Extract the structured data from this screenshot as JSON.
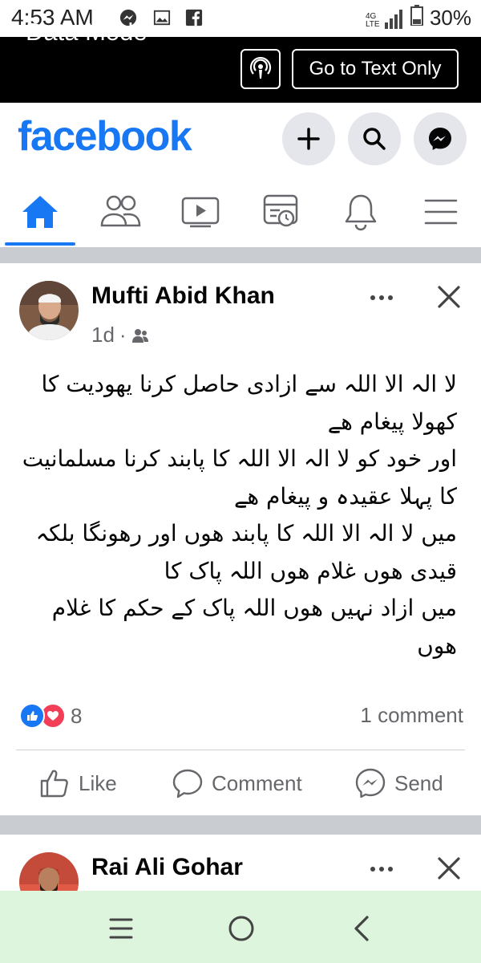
{
  "status_bar": {
    "time": "4:53 AM",
    "network": "4G LTE",
    "battery": "30%",
    "app_icons": [
      "messenger-icon",
      "image-icon",
      "facebook-icon"
    ]
  },
  "data_mode": {
    "label": "Data Mode",
    "text_only_label": "Go to Text Only"
  },
  "header": {
    "logo": "facebook",
    "brand_color": "#1877f2",
    "buttons": [
      "plus-icon",
      "search-icon",
      "messenger-icon"
    ]
  },
  "nav": {
    "items": [
      "home",
      "friends",
      "watch",
      "pages",
      "notifications",
      "menu"
    ],
    "active": "home"
  },
  "post1": {
    "author": "Mufti Abid Khan",
    "time": "1d",
    "privacy_icon": "friends-icon",
    "lines": [
      "لا الہ الا اللہ سے ازادی حاصل کرنا یھودیت کا",
      "کھولا پیغام ھے",
      "اور خود کو لا الہ الا اللہ کا پابند کرنا مسلمانیت",
      "کا پہلا عقیدہ و پیغام ھے",
      "میں لا الہ الا اللہ کا پابند ھوں اور رھونگا بلکہ",
      "قیدی ھوں غلام ھوں اللہ پاک کا",
      "میں ازاد نہیں ھوں اللہ پاک کے حکم کا غلام",
      "ھوں"
    ],
    "reaction_count": "8",
    "comment_count": "1 comment",
    "actions": {
      "like": "Like",
      "comment": "Comment",
      "send": "Send"
    }
  },
  "post2": {
    "author": "Rai Ali Gohar"
  }
}
